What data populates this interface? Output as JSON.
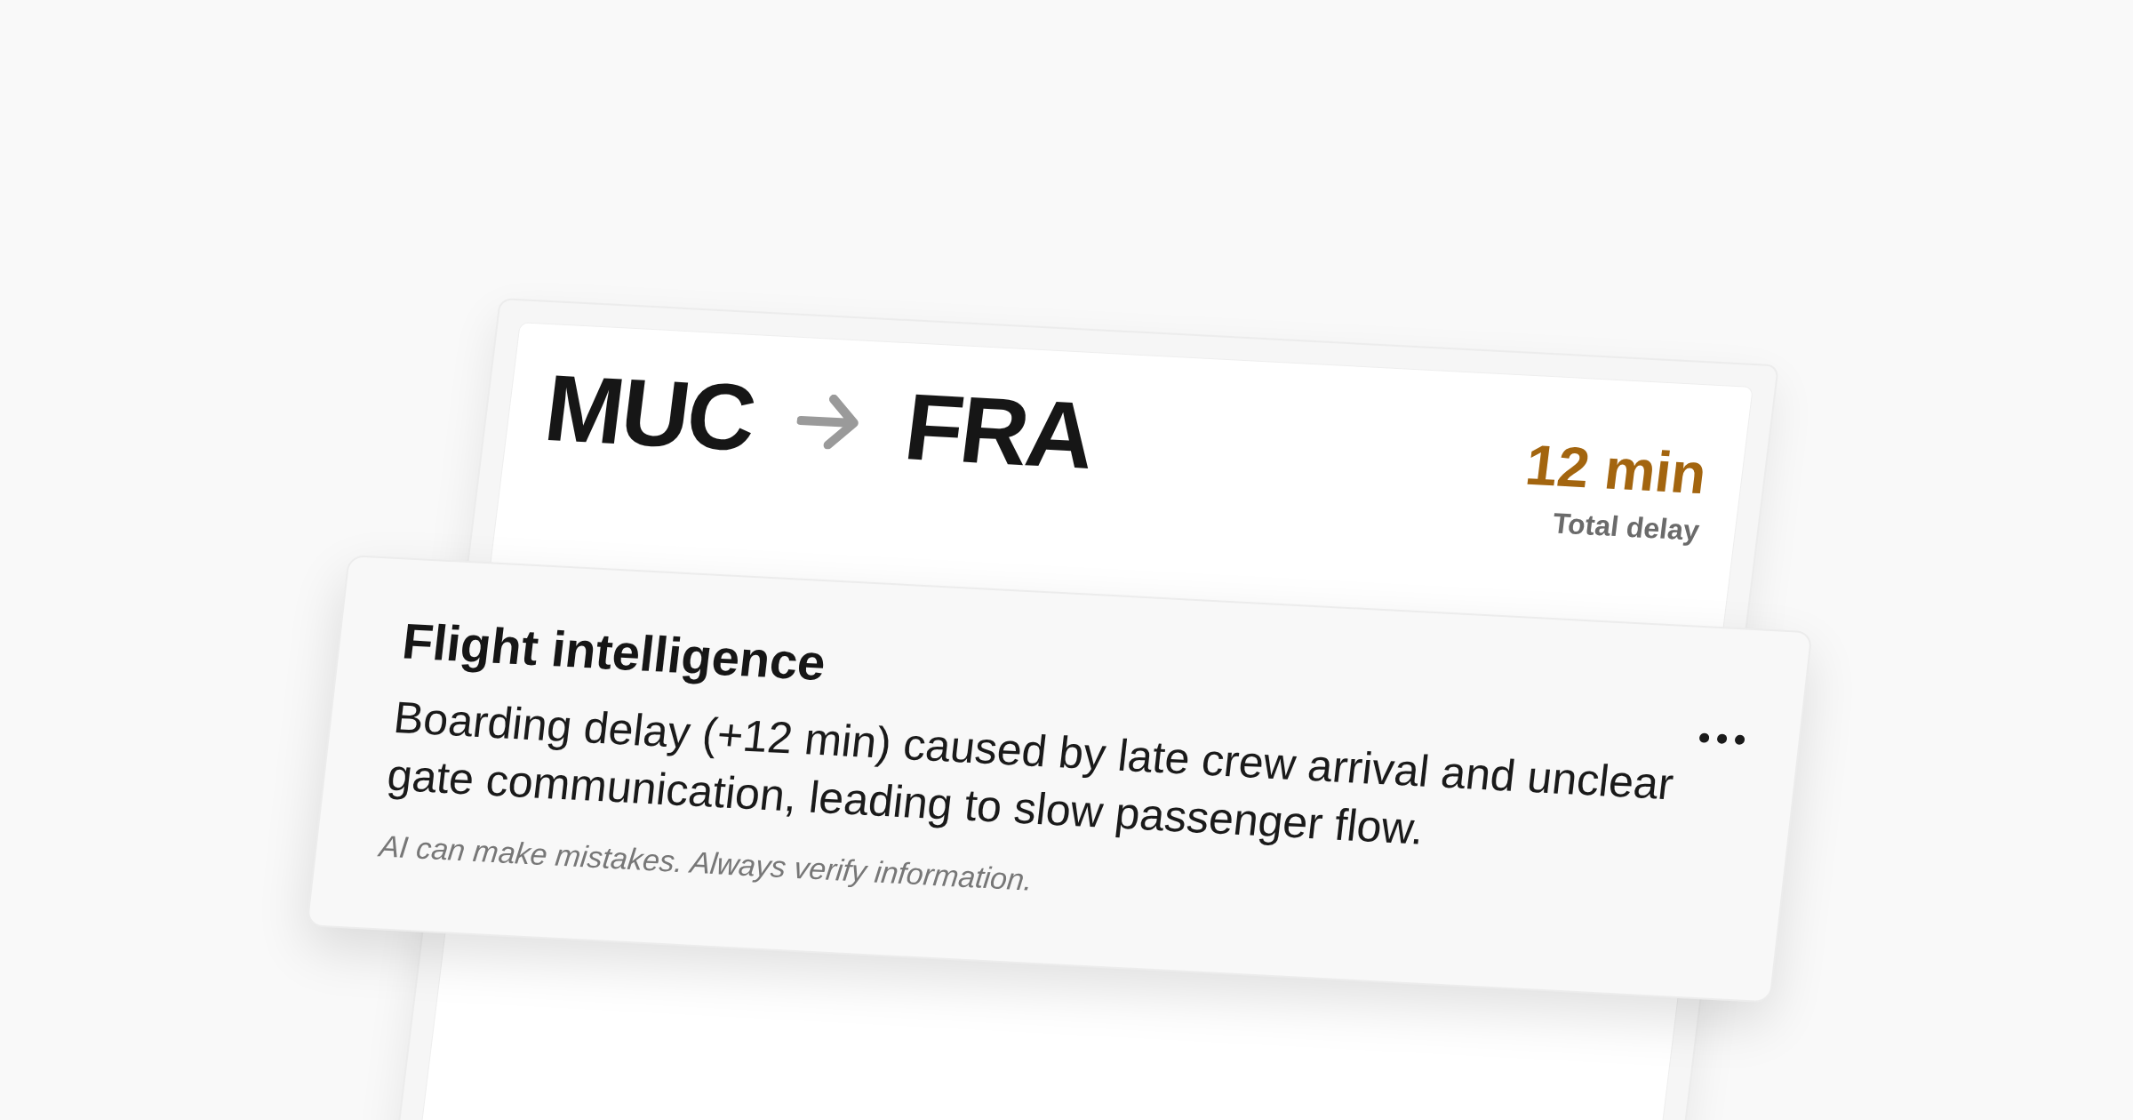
{
  "route": {
    "origin": "MUC",
    "destination": "FRA"
  },
  "delay": {
    "value": "12 min",
    "label": "Total delay"
  },
  "insight": {
    "title": "Flight intelligence",
    "body": "Boarding delay (+12 min) caused by late crew arrival and unclear gate communication, leading to slow passenger flow.",
    "disclaimer": "AI can make mistakes. Always verify information."
  }
}
